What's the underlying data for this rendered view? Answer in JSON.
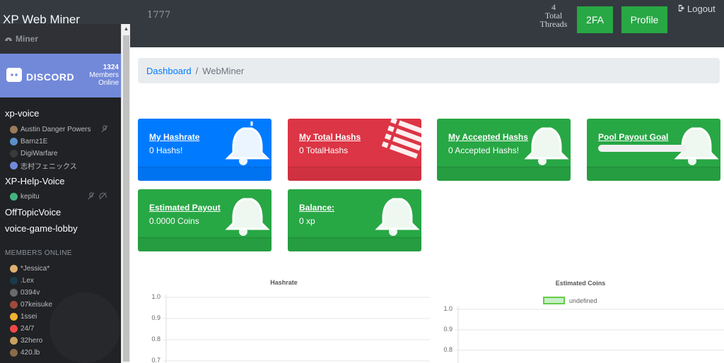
{
  "app": {
    "brand": "XP Web Miner",
    "top_count": "1777"
  },
  "topbar": {
    "threads_count": "4",
    "threads_label": "Total Threads",
    "twofa_label": "2FA",
    "profile_label": "Profile",
    "logout_label": "Logout"
  },
  "sidebar": {
    "header_title": "Miner",
    "discord_logo_text": "DISCORD",
    "online_count": "1324",
    "online_label_1": "Members",
    "online_label_2": "Online",
    "channels": [
      {
        "name": "xp-voice",
        "members": [
          "Austin Danger Powers",
          "Barnz1E",
          "DigiWarfare",
          "志村フェニックス"
        ]
      },
      {
        "name": "XP-Help-Voice",
        "members": [
          "kepitu"
        ]
      },
      {
        "name": "OffTopicVoice",
        "members": []
      },
      {
        "name": "voice-game-lobby",
        "members": []
      }
    ],
    "members_online_title": "MEMBERS ONLINE",
    "members_online": [
      "*Jessica*",
      ".Lex",
      "0394v",
      "07keisuke",
      "1ssei",
      "24/7",
      "32hero",
      "420.lb"
    ]
  },
  "breadcrumb": {
    "home": "Dashboard",
    "current": "WebMiner"
  },
  "cards": [
    {
      "title": "My Hashrate",
      "value": "0 Hashs!",
      "color": "#007bff",
      "icon": "bell-icon"
    },
    {
      "title": "My Total Hashs",
      "value": "0 TotalHashs",
      "color": "#dc3545",
      "icon": "list-icon"
    },
    {
      "title": "My Accepted Hashs",
      "value": "0 Accepted Hashs!",
      "color": "#28a745",
      "icon": "bell-icon"
    },
    {
      "title": "Pool Payout Goal",
      "value": "",
      "progress": 1.0,
      "color": "#28a745",
      "icon": "bell-icon"
    },
    {
      "title": "Estimated Payout",
      "value": "0.0000 Coins",
      "color": "#28a745",
      "icon": "bell-icon"
    },
    {
      "title": "Balance:",
      "value": "0 xp",
      "color": "#28a745",
      "icon": "bell-icon"
    }
  ],
  "chart_data": [
    {
      "type": "line",
      "title": "Hashrate",
      "series": [],
      "y_ticks": [
        "1.0",
        "0.9",
        "0.8",
        "0.7"
      ],
      "ylim": [
        0.7,
        1.0
      ],
      "grid": true
    },
    {
      "type": "line",
      "title": "Estimated Coins",
      "series": [
        {
          "name": "undefined",
          "values": []
        }
      ],
      "legend": "top",
      "y_ticks": [
        "1.0",
        "0.9",
        "0.8"
      ],
      "ylim": [
        0.8,
        1.0
      ],
      "grid": true
    }
  ]
}
